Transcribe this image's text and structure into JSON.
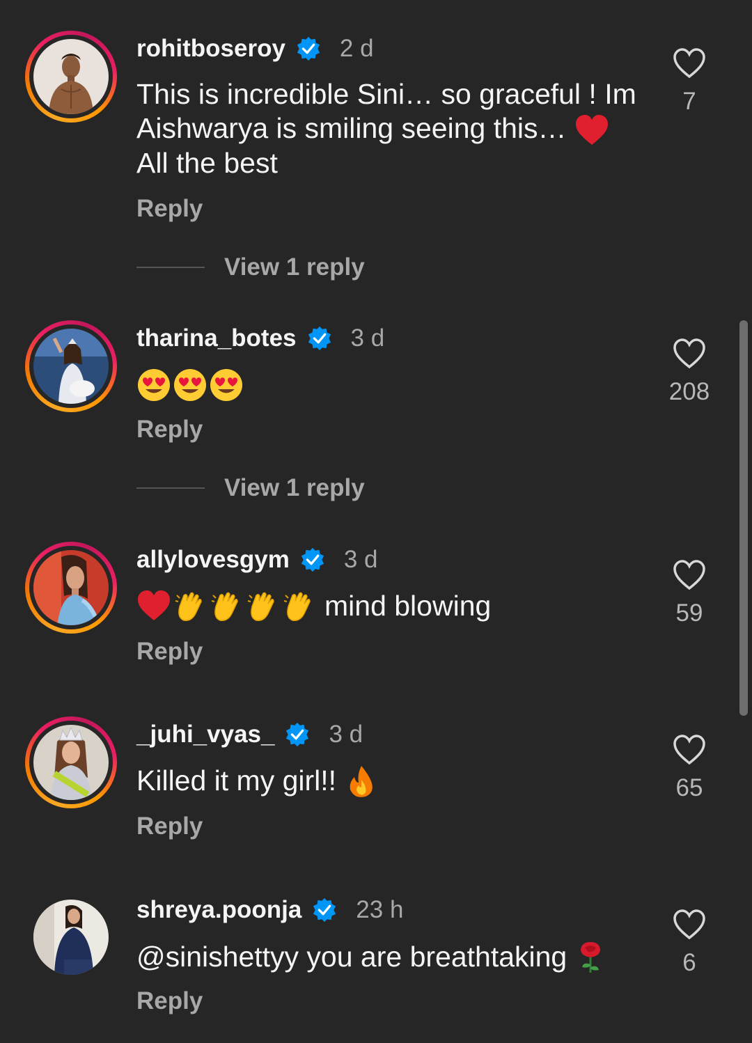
{
  "comments": [
    {
      "username": "rohitboseroy",
      "time": "2 d",
      "text_lines": [
        "This is incredible Sini… so graceful ! Im",
        "Aishwarya is smiling seeing this…",
        "All the best"
      ],
      "reply_label": "Reply",
      "view_replies": "View 1 reply",
      "likes": "7",
      "avatar_icon": "man-portrait-avatar"
    },
    {
      "username": "tharina_botes",
      "time": "3 d",
      "text": "",
      "reply_label": "Reply",
      "view_replies": "View 1 reply",
      "likes": "208",
      "avatar_icon": "pageant-woman-avatar"
    },
    {
      "username": "allylovesgym",
      "time": "3 d",
      "text": "mind blowing",
      "reply_label": "Reply",
      "likes": "59",
      "avatar_icon": "woman-portrait-avatar"
    },
    {
      "username": "_juhi_vyas_",
      "time": "3 d",
      "text": "Killed it my girl!!",
      "reply_label": "Reply",
      "likes": "65",
      "avatar_icon": "crowned-woman-avatar"
    },
    {
      "username": "shreya.poonja",
      "time": "23 h",
      "text": "@sinishettyy you are breathtaking",
      "reply_label": "Reply",
      "likes": "6",
      "avatar_icon": "woman-sitting-avatar"
    }
  ],
  "colors": {
    "background": "#262626",
    "verified_blue": "#0095f6",
    "secondary_text": "#a8a8a8",
    "story_ring": "#e91e63"
  }
}
